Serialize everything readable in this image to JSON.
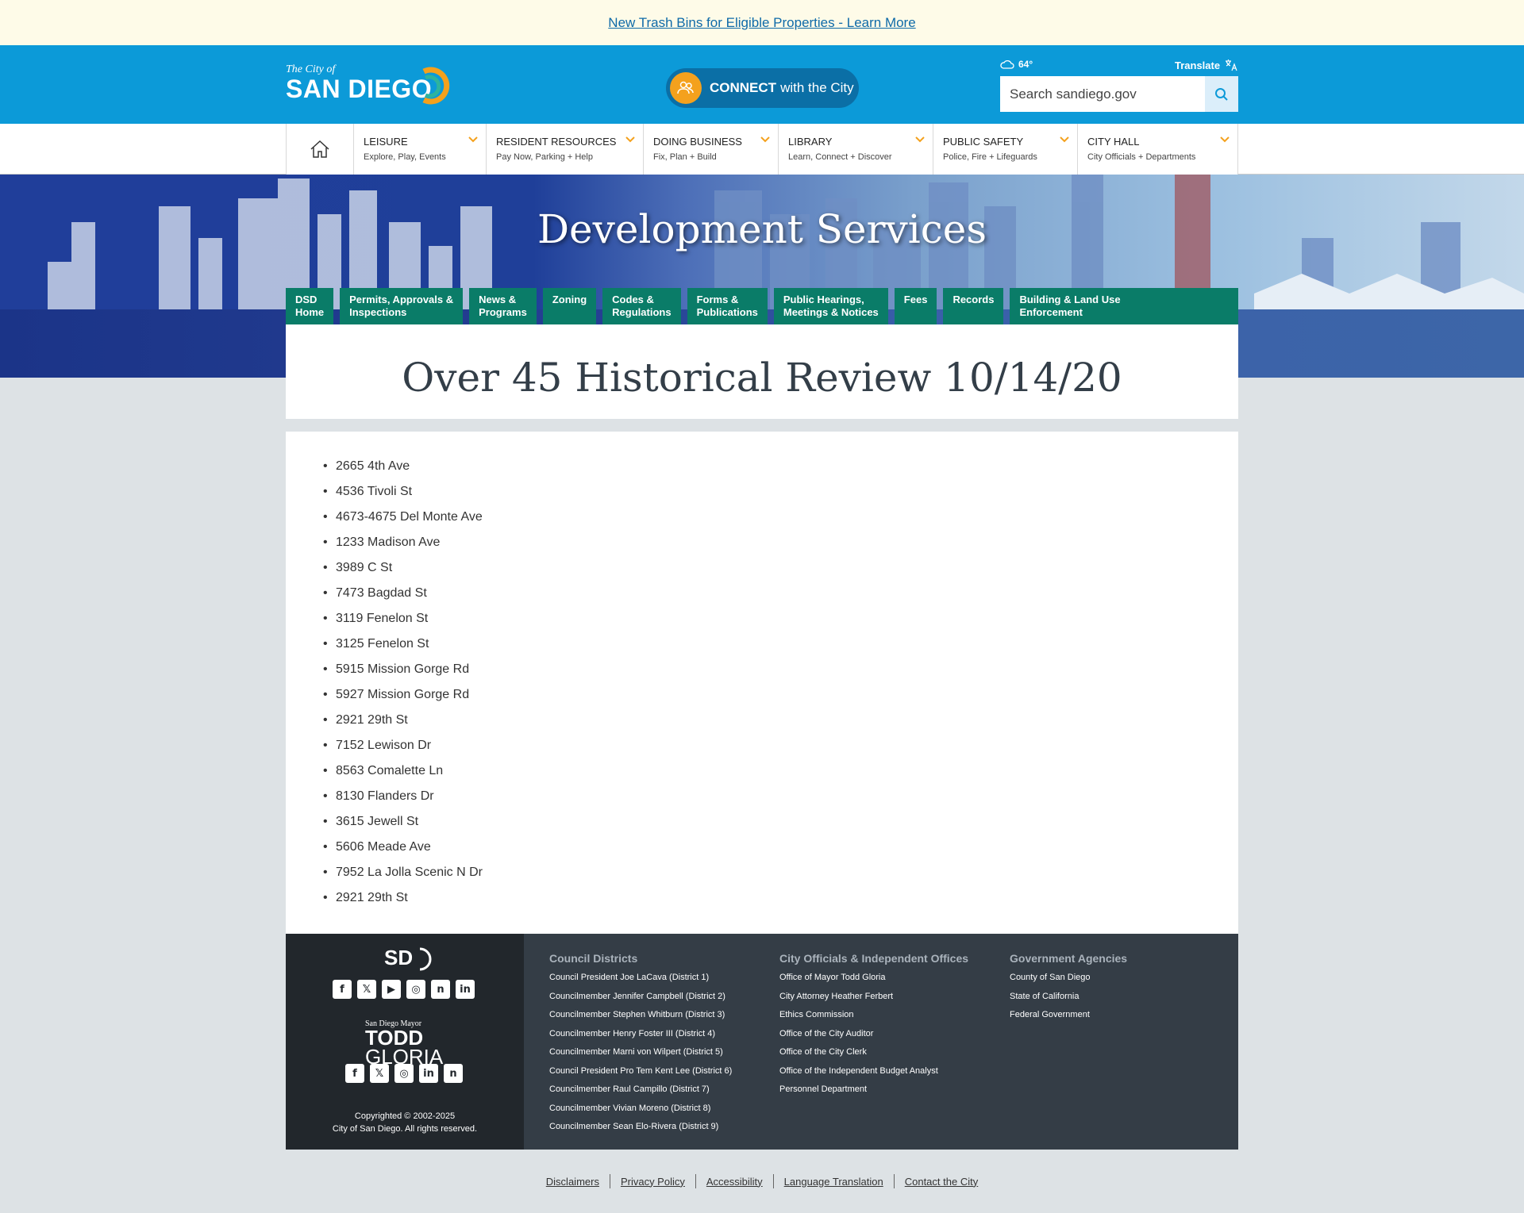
{
  "alert": {
    "text": "New Trash Bins for Eligible Properties - Learn More"
  },
  "header": {
    "logo_small": "The City of",
    "logo_big": "SAN DIEGO",
    "connect_bold": "CONNECT",
    "connect_rest": "with the City",
    "weather": "64°",
    "translate": "Translate",
    "search_placeholder": "Search sandiego.gov"
  },
  "nav": {
    "items": [
      {
        "title": "LEISURE",
        "sub": "Explore, Play, Events"
      },
      {
        "title": "RESIDENT RESOURCES",
        "sub": "Pay Now, Parking + Help"
      },
      {
        "title": "DOING BUSINESS",
        "sub": "Fix, Plan + Build"
      },
      {
        "title": "LIBRARY",
        "sub": "Learn, Connect + Discover"
      },
      {
        "title": "PUBLIC SAFETY",
        "sub": "Police, Fire + Lifeguards"
      },
      {
        "title": "CITY HALL",
        "sub": "City Officials + Departments"
      }
    ]
  },
  "hero": {
    "title": "Development Services"
  },
  "subnav": {
    "items": [
      [
        "DSD",
        "Home"
      ],
      [
        "Permits, Approvals &",
        "Inspections"
      ],
      [
        "News &",
        "Programs"
      ],
      [
        "Zoning",
        ""
      ],
      [
        "Codes &",
        "Regulations"
      ],
      [
        "Forms &",
        "Publications"
      ],
      [
        "Public Hearings,",
        "Meetings & Notices"
      ],
      [
        "Fees",
        ""
      ],
      [
        "Records",
        ""
      ],
      [
        "Building & Land Use",
        "Enforcement"
      ]
    ]
  },
  "page": {
    "title": "Over 45 Historical Review 10/14/20",
    "addresses": [
      "2665 4th Ave",
      "4536 Tivoli St",
      "4673-4675 Del Monte Ave",
      "1233 Madison Ave",
      "3989 C St",
      "7473 Bagdad St",
      "3119 Fenelon St",
      "3125 Fenelon St",
      "5915 Mission Gorge Rd",
      "5927 Mission Gorge Rd",
      "2921 29th St",
      "7152 Lewison Dr",
      "8563 Comalette Ln",
      "8130 Flanders Dr",
      "3615 Jewell St",
      "5606 Meade Ave",
      "7952 La Jolla Scenic N Dr",
      "2921 29th St"
    ]
  },
  "footer": {
    "sd_logo": "SD",
    "mayor_line1": "San Diego Mayor",
    "mayor_line2": "TODD",
    "mayor_line3": "GLORIA",
    "copyright_line1": "Copyrighted © 2002-2025",
    "copyright_line2": "City of San Diego. All rights reserved.",
    "columns": [
      {
        "heading": "Council Districts",
        "links": [
          "Council President Joe LaCava (District 1)",
          "Councilmember Jennifer Campbell (District 2)",
          "Councilmember Stephen Whitburn (District 3)",
          "Councilmember Henry Foster III (District 4)",
          "Councilmember Marni von Wilpert (District 5)",
          "Council President Pro Tem Kent Lee (District 6)",
          "Councilmember Raul Campillo (District 7)",
          "Councilmember Vivian Moreno (District 8)",
          "Councilmember Sean Elo-Rivera (District 9)"
        ]
      },
      {
        "heading": "City Officials & Independent Offices",
        "links": [
          "Office of Mayor Todd Gloria",
          "City Attorney Heather Ferbert",
          "Ethics Commission",
          "Office of the City Auditor",
          "Office of the City Clerk",
          "Office of the Independent Budget Analyst",
          "Personnel Department"
        ]
      },
      {
        "heading": "Government Agencies",
        "links": [
          "County of San Diego",
          "State of California",
          "Federal Government"
        ]
      }
    ],
    "bottom_links": [
      "Disclaimers",
      "Privacy Policy",
      "Accessibility",
      "Language Translation",
      "Contact the City"
    ]
  },
  "colors": {
    "header_blue": "#0c9ad8",
    "subnav_green": "#0a7c68",
    "accent_orange": "#f4a11d",
    "footer_dark": "#22272c",
    "footer_slate": "#343d46"
  }
}
